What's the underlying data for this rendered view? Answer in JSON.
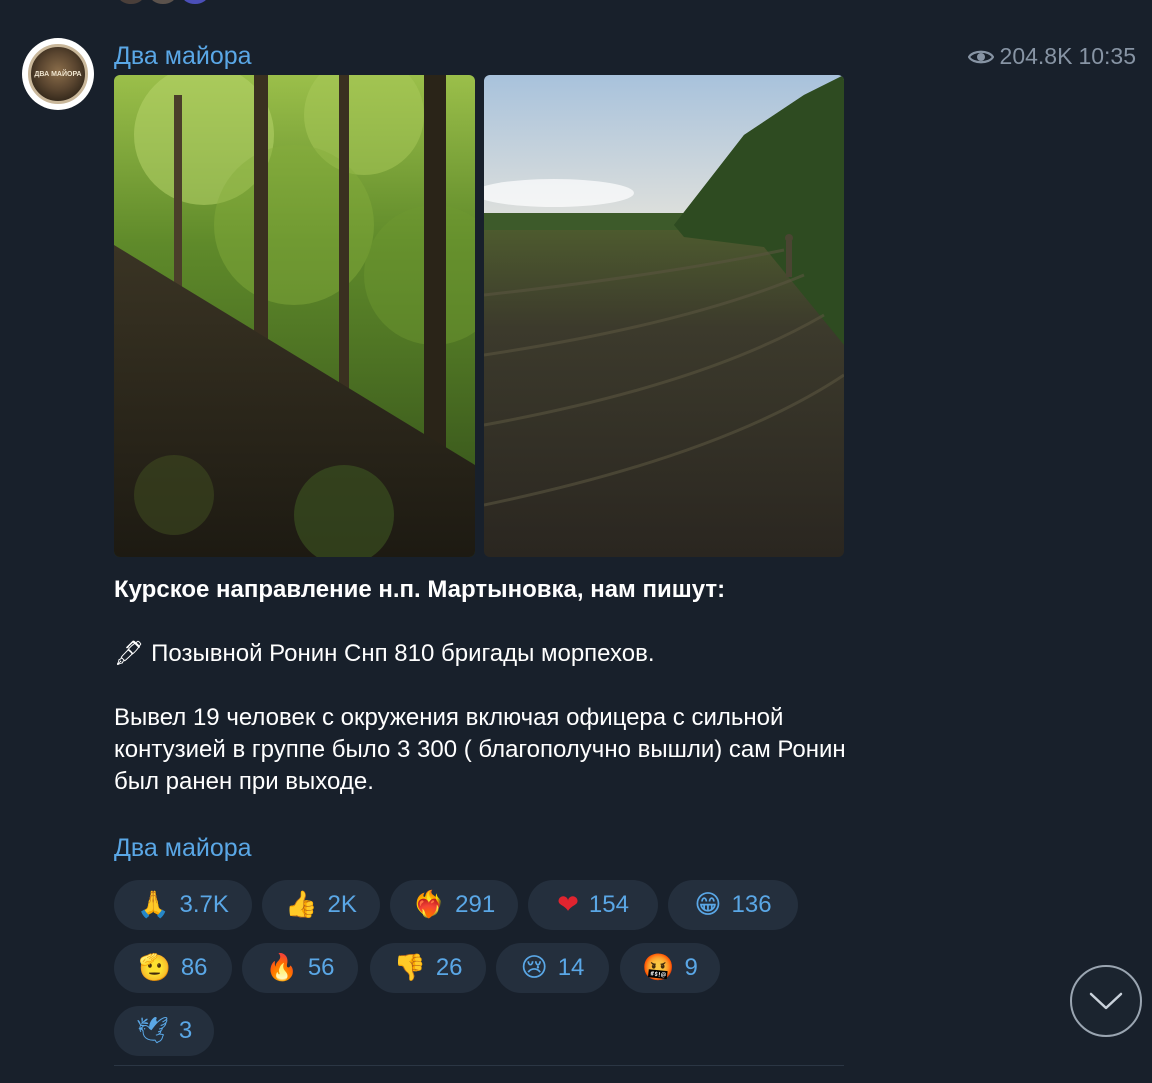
{
  "channel": {
    "name": "Два майора",
    "avatar_text": "ДВА МАЙОРА",
    "views": "204.8K",
    "time": "10:35"
  },
  "post": {
    "headline": "Курское направление н.п. Мартыновка, нам пишут:",
    "line1_icon": "🖋",
    "line1": "Позывной Ронин Снп 810 бригады морпехов.",
    "paragraph": "Вывел 19 человек с окружения включая офицера с сильной контузией в группе было 3 300 ( благополучно вышли) сам Ронин был ранен при выходе.",
    "signature": "Два майора"
  },
  "reactions": [
    {
      "emoji": "🙏",
      "count": "3.7K"
    },
    {
      "emoji": "👍",
      "count": "2K"
    },
    {
      "emoji": "❤‍🔥",
      "count": "291"
    },
    {
      "emoji": "❤",
      "count": "154"
    },
    {
      "emoji": "😁",
      "count": "136"
    },
    {
      "emoji": "🫡",
      "count": "86"
    },
    {
      "emoji": "🔥",
      "count": "56"
    },
    {
      "emoji": "👎",
      "count": "26"
    },
    {
      "emoji": "😢",
      "count": "14"
    },
    {
      "emoji": "🤬",
      "count": "9"
    },
    {
      "emoji": "🕊",
      "count": "3"
    }
  ],
  "icons": {
    "views": "eye-icon",
    "scroll": "chevron-down-icon"
  },
  "colors": {
    "background": "#18202b",
    "accent": "#5aa7e6",
    "chip": "#242f3d",
    "meta": "#8794a4"
  }
}
